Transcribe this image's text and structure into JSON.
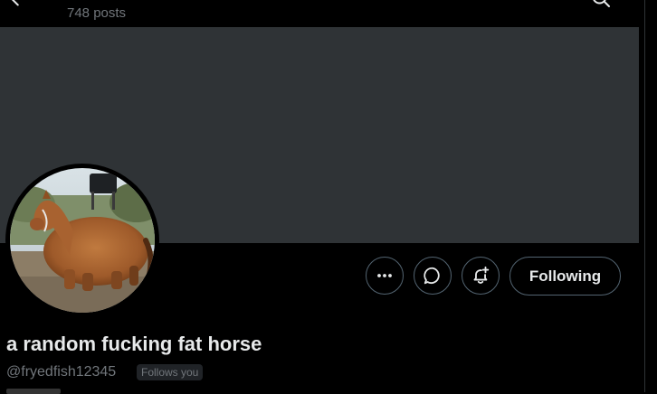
{
  "header": {
    "post_count": "748 posts"
  },
  "profile": {
    "display_name": "a random fucking fat horse",
    "handle": "@fryedfish12345",
    "follows_you": "Follows you"
  },
  "actions": {
    "following_label": "Following"
  },
  "colors": {
    "background": "#000000",
    "banner": "#2f3336",
    "text_primary": "#e7e9ea",
    "text_secondary": "#71767b",
    "button_border": "#536471"
  },
  "icons": [
    "back-arrow-icon",
    "search-icon",
    "more-icon",
    "message-icon",
    "notification-bell-plus-icon"
  ]
}
